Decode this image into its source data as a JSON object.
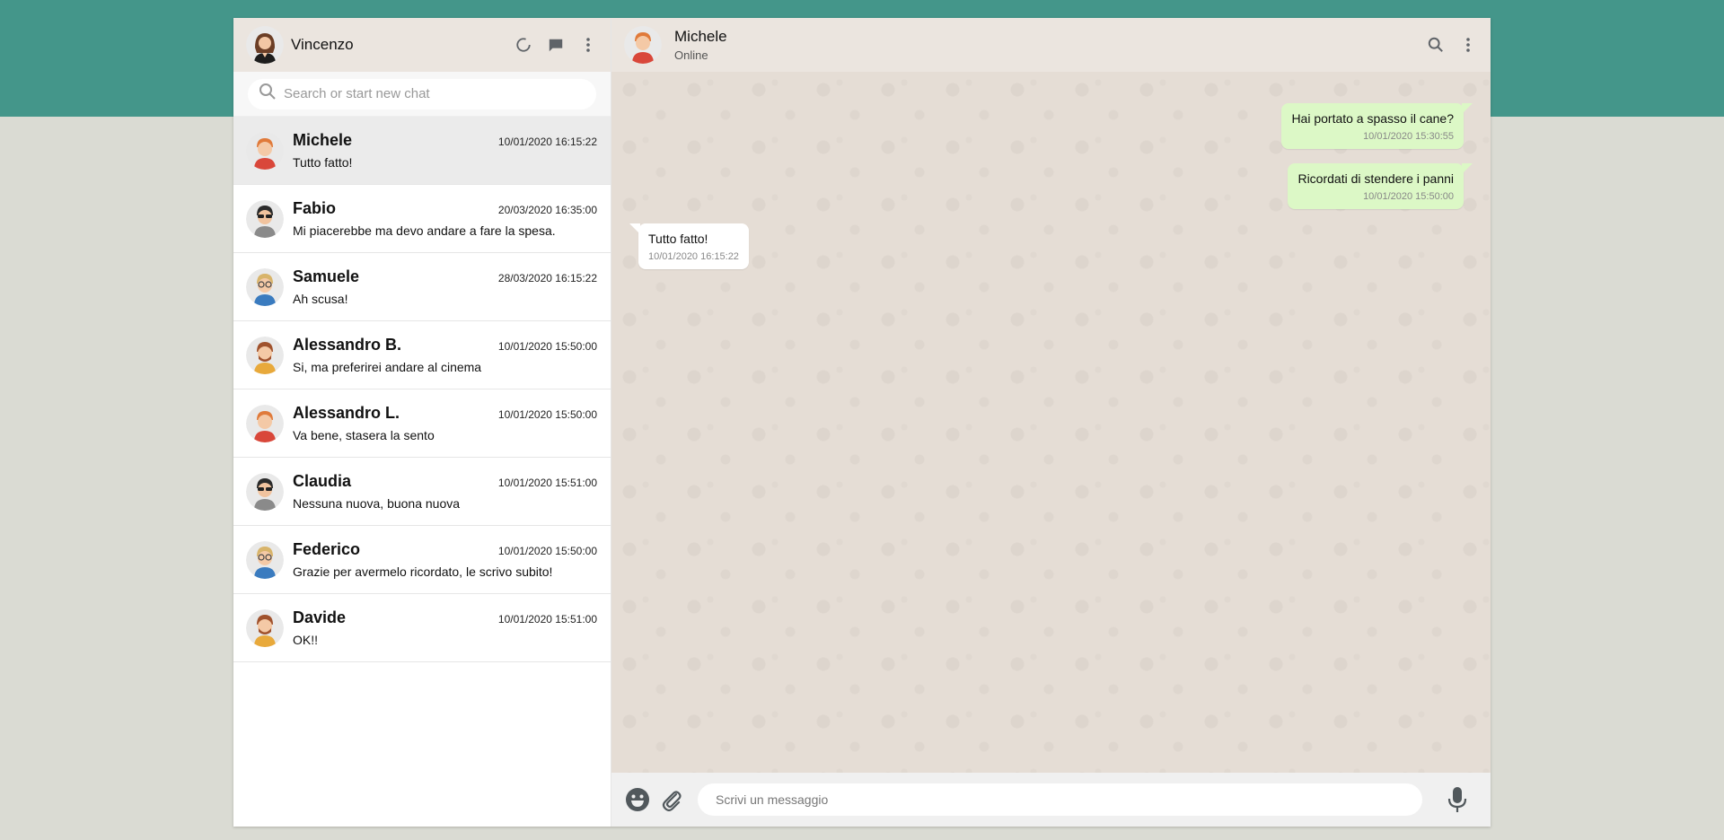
{
  "user": {
    "name": "Vincenzo"
  },
  "search": {
    "placeholder": "Search or start new chat"
  },
  "contacts": [
    {
      "name": "Michele",
      "time": "10/01/2020 16:15:22",
      "message": "Tutto fatto!",
      "active": true
    },
    {
      "name": "Fabio",
      "time": "20/03/2020 16:35:00",
      "message": "Mi piacerebbe ma devo andare a fare la spesa."
    },
    {
      "name": "Samuele",
      "time": "28/03/2020 16:15:22",
      "message": "Ah scusa!"
    },
    {
      "name": "Alessandro B.",
      "time": "10/01/2020 15:50:00",
      "message": "Si, ma preferirei andare al cinema"
    },
    {
      "name": "Alessandro L.",
      "time": "10/01/2020 15:50:00",
      "message": "Va bene, stasera la sento"
    },
    {
      "name": "Claudia",
      "time": "10/01/2020 15:51:00",
      "message": "Nessuna nuova, buona nuova"
    },
    {
      "name": "Federico",
      "time": "10/01/2020 15:50:00",
      "message": "Grazie per avermelo ricordato, le scrivo subito!"
    },
    {
      "name": "Davide",
      "time": "10/01/2020 15:51:00",
      "message": "OK!!"
    }
  ],
  "chat": {
    "name": "Michele",
    "status": "Online",
    "messages": [
      {
        "type": "sent",
        "text": "Hai portato a spasso il cane?",
        "time": "10/01/2020 15:30:55"
      },
      {
        "type": "sent",
        "text": "Ricordati di stendere i panni",
        "time": "10/01/2020 15:50:00"
      },
      {
        "type": "received",
        "text": "Tutto fatto!",
        "time": "10/01/2020 16:15:22"
      }
    ]
  },
  "composer": {
    "placeholder": "Scrivi un messaggio"
  },
  "icons": {
    "status": "status-icon",
    "new_chat": "new-chat-icon",
    "menu": "kebab-menu-icon",
    "search": "search-icon",
    "emoji": "emoji-icon",
    "attach": "paperclip-icon",
    "mic": "microphone-icon"
  },
  "colors": {
    "accent": "#44968a",
    "header": "#ebe5df",
    "sent_bubble": "#dcf8c6",
    "chat_bg": "#e5ddd5",
    "active_row": "#ebebeb"
  }
}
